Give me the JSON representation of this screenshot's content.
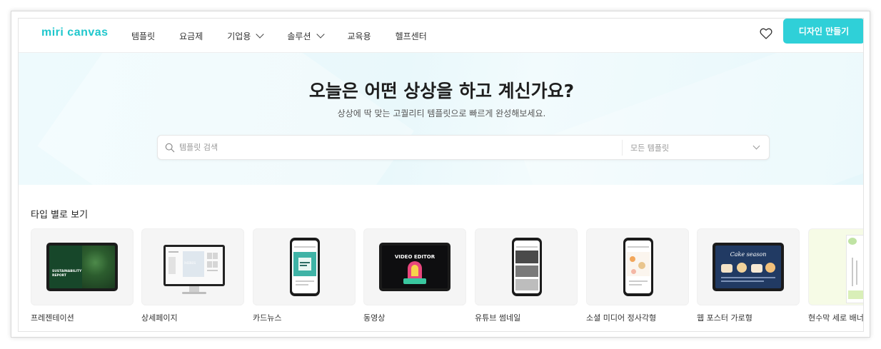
{
  "header": {
    "logo": "miri canvas",
    "nav": [
      {
        "label": "템플릿",
        "dropdown": false
      },
      {
        "label": "요금제",
        "dropdown": false
      },
      {
        "label": "기업용",
        "dropdown": true
      },
      {
        "label": "솔루션",
        "dropdown": true
      },
      {
        "label": "교육용",
        "dropdown": false
      },
      {
        "label": "헬프센터",
        "dropdown": false
      }
    ],
    "favorites_icon": "heart-icon",
    "cta_label": "디자인 만들기"
  },
  "hero": {
    "title": "오늘은 어떤 상상을 하고 계신가요?",
    "subtitle": "상상에 딱 맞는 고퀄리티 템플릿으로 빠르게 완성해보세요.",
    "search": {
      "placeholder": "템플릿 검색",
      "value": "",
      "filter_selected": "모든 템플릿"
    }
  },
  "types": {
    "title": "타입 별로 보기",
    "items": [
      {
        "label": "프레젠테이션",
        "device": "tablet",
        "thumb_text": "SUSTAINABILITY REPORT"
      },
      {
        "label": "상세페이지",
        "device": "monitor",
        "thumb_text": "MIRIS"
      },
      {
        "label": "카드뉴스",
        "device": "phone"
      },
      {
        "label": "동영상",
        "device": "tablet",
        "thumb_text": "VIDEO EDITOR"
      },
      {
        "label": "유튜브 썸네일",
        "device": "phone"
      },
      {
        "label": "소셜 미디어 정사각형",
        "device": "phone"
      },
      {
        "label": "웹 포스터 가로형",
        "device": "tablet",
        "thumb_text": "Cake season"
      },
      {
        "label": "현수막 세로 배너",
        "device": "banner"
      }
    ]
  },
  "colors": {
    "brand": "#1fc7cc",
    "cta": "#2fd0d8",
    "hero_bg": "#eaf8fb"
  }
}
